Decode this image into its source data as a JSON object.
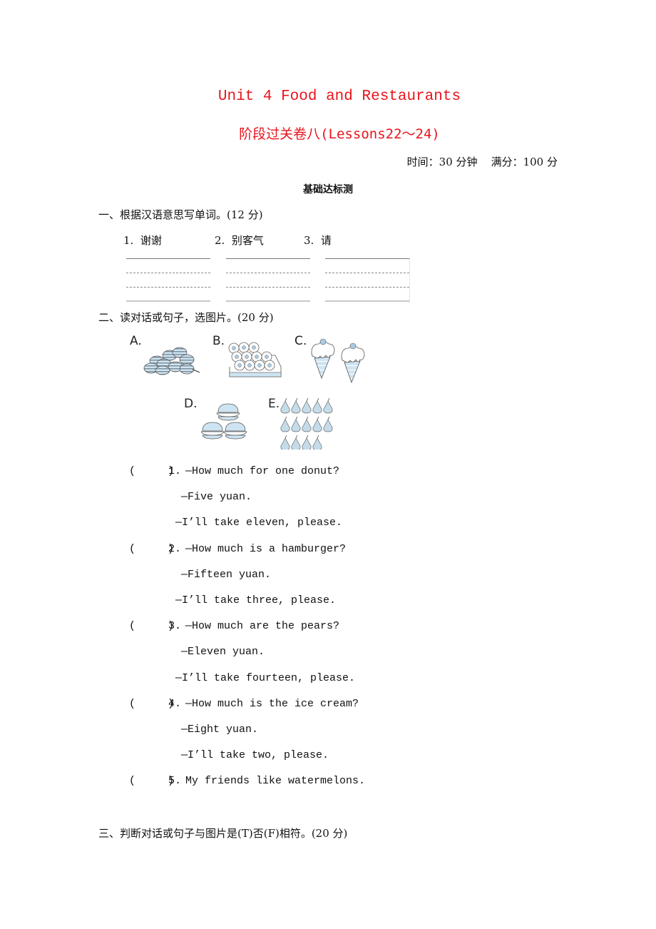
{
  "header": {
    "title": "Unit 4 Food and Restaurants",
    "subtitle": "阶段过关卷八(Lessons22～24)",
    "time_label": "时间：30 分钟",
    "score_label": "满分：100 分",
    "section_heading": "基础达标测"
  },
  "section1": {
    "title": "一、根据汉语意思写单词。(12 分)",
    "items": [
      {
        "num": "1.",
        "text": "谢谢"
      },
      {
        "num": "2.",
        "text": "别客气"
      },
      {
        "num": "3.",
        "text": "请"
      }
    ]
  },
  "section2": {
    "title": "二、读对话或句子，选图片。(20 分)",
    "pictures": [
      {
        "label": "A.",
        "icon": "watermelons-image"
      },
      {
        "label": "B.",
        "icon": "donuts-image"
      },
      {
        "label": "C.",
        "icon": "ice-creams-image"
      },
      {
        "label": "D.",
        "icon": "hamburgers-image"
      },
      {
        "label": "E.",
        "icon": "pears-image"
      }
    ],
    "questions": [
      {
        "paren": "(     )",
        "num": "1.",
        "lines": [
          "—How much for one donut?",
          "—Five yuan.",
          "—I’ll take eleven, please."
        ]
      },
      {
        "paren": "(     )",
        "num": "2.",
        "lines": [
          "—How much is a hamburger?",
          "—Fifteen yuan.",
          "—I’ll take three, please."
        ]
      },
      {
        "paren": "(     )",
        "num": "3.",
        "lines": [
          "—How much are the pears?",
          "—Eleven yuan.",
          "—I’ll take fourteen, please."
        ]
      },
      {
        "paren": "(     )",
        "num": "4.",
        "lines": [
          "—How much is the ice cream?",
          "—Eight yuan.",
          "—I’ll take two, please."
        ]
      },
      {
        "paren": "(     )",
        "num": "5.",
        "lines": [
          "My friends like watermelons."
        ]
      }
    ]
  },
  "section3": {
    "title": "三、判断对话或句子与图片是(T)否(F)相符。(20 分)"
  },
  "colors": {
    "title_red": "#e8141c",
    "illustration_blue": "#b9d8ec"
  }
}
